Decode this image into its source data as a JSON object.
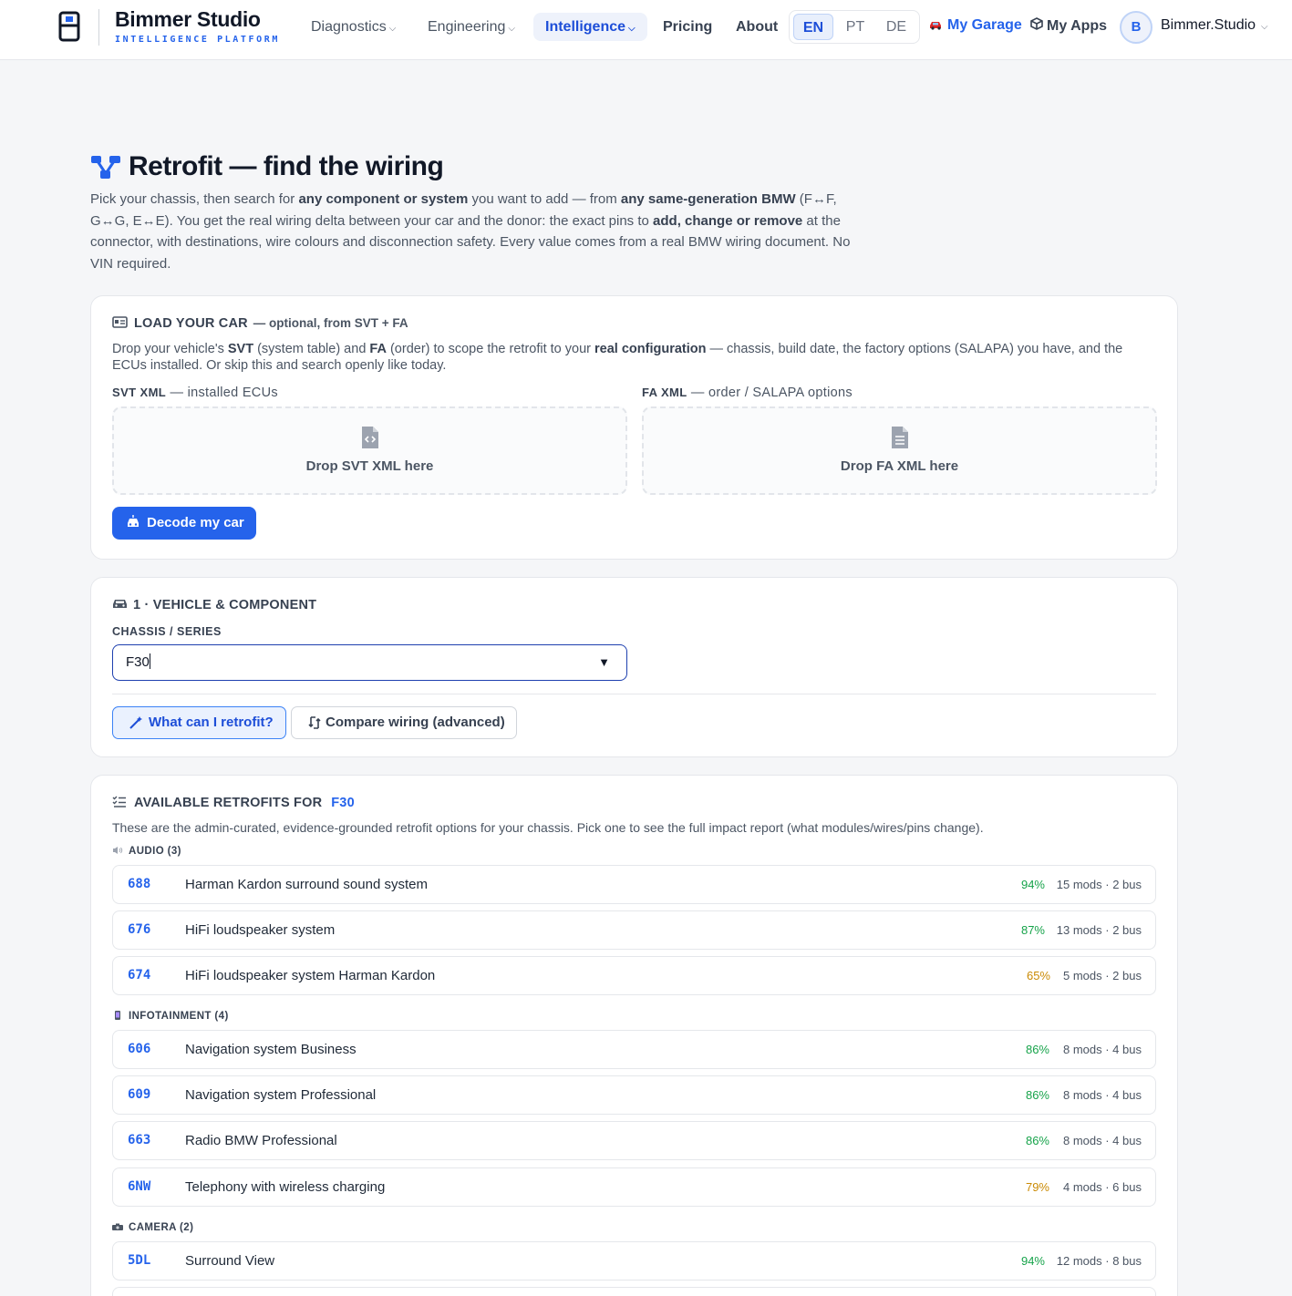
{
  "brand": {
    "name": "Bimmer Studio",
    "subtitle": "INTELLIGENCE PLATFORM"
  },
  "nav": {
    "diagnostics": "Diagnostics",
    "engineering": "Engineering",
    "intelligence": "Intelligence",
    "pricing": "Pricing",
    "about": "About"
  },
  "languages": [
    "EN",
    "PT",
    "DE"
  ],
  "header": {
    "garage": "My Garage",
    "apps": "My Apps",
    "avatar_initial": "B",
    "user": "Bimmer.Studio"
  },
  "page": {
    "title": "Retrofit — find the wiring"
  },
  "intro": {
    "p1": "Pick your chassis, then search for ",
    "b1": "any component or system",
    "p2": " you want to add — from ",
    "b2": "any same-generation BMW",
    "p3": " (F↔F, G↔G, E↔E). You get the real wiring delta between your car and the donor: the exact pins to ",
    "b3": "add, change or remove",
    "p4": " at the connector, with destinations, wire colours and disconnection safety. Every value comes from a real BMW wiring document. No VIN required."
  },
  "load_car": {
    "title": "LOAD YOUR CAR",
    "subtitle": "— optional, from SVT + FA",
    "d1": "Drop your vehicle's ",
    "d_svt": "SVT",
    "d2": " (system table) and ",
    "d_fa": "FA",
    "d3": " (order) to scope the retrofit to your ",
    "d_real": "real configuration",
    "d4": " — chassis, build date, the factory options (SALAPA) you have, and the ECUs installed. Or skip this and search openly like today.",
    "svt_label": "SVT XML",
    "svt_hint": " — installed ECUs",
    "fa_label": "FA XML",
    "fa_hint": " — order / SALAPA options",
    "svt_drop": "Drop SVT XML here",
    "fa_drop": "Drop FA XML here",
    "decode_button": "Decode my car"
  },
  "vehicle": {
    "title": "1 · VEHICLE & COMPONENT",
    "chassis_label": "CHASSIS / SERIES",
    "chassis_value": "F30",
    "retrofit_button": "What can I retrofit?",
    "compare_button": "Compare wiring (advanced)"
  },
  "available": {
    "title": "AVAILABLE RETROFITS FOR",
    "chassis": "F30",
    "description": "These are the admin-curated, evidence-grounded retrofit options for your chassis. Pick one to see the full impact report (what modules/wires/pins change).",
    "categories": [
      {
        "label": "AUDIO (3)",
        "items": [
          {
            "code": "688",
            "name": "Harman Kardon surround sound system",
            "pct": "94%",
            "meta": "15 mods · 2 bus"
          },
          {
            "code": "676",
            "name": "HiFi loudspeaker system",
            "pct": "87%",
            "meta": "13 mods · 2 bus"
          },
          {
            "code": "674",
            "name": "HiFi loudspeaker system Harman Kardon",
            "pct": "65%",
            "meta": "5 mods · 2 bus"
          }
        ]
      },
      {
        "label": "INFOTAINMENT (4)",
        "items": [
          {
            "code": "606",
            "name": "Navigation system Business",
            "pct": "86%",
            "meta": "8 mods · 4 bus"
          },
          {
            "code": "609",
            "name": "Navigation system Professional",
            "pct": "86%",
            "meta": "8 mods · 4 bus"
          },
          {
            "code": "663",
            "name": "Radio BMW Professional",
            "pct": "86%",
            "meta": "8 mods · 4 bus"
          },
          {
            "code": "6NW",
            "name": "Telephony with wireless charging",
            "pct": "79%",
            "meta": "4 mods · 6 bus"
          }
        ]
      },
      {
        "label": "CAMERA (2)",
        "items": [
          {
            "code": "5DL",
            "name": "Surround View",
            "pct": "94%",
            "meta": "12 mods · 8 bus"
          }
        ]
      }
    ]
  },
  "colors": {
    "accent": "#2563eb",
    "high": "#16a34a",
    "medium": "#ca8a04"
  }
}
